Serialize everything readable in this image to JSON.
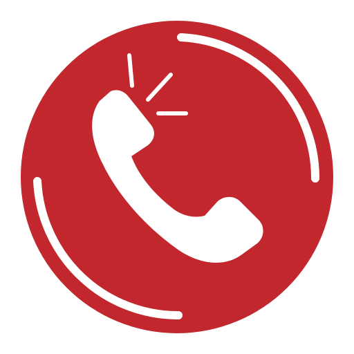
{
  "icon": {
    "name": "phone-call-icon",
    "colors": {
      "badge": "#C1272D",
      "foreground": "#FFFFFF",
      "background": "#FFFFFF"
    },
    "parts": [
      "red-circle-badge",
      "arc-accents",
      "phone-handset",
      "ringing-lines"
    ]
  }
}
